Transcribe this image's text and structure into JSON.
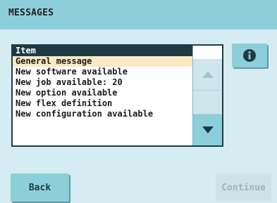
{
  "header": {
    "title": "MESSAGES"
  },
  "list": {
    "column_header": "Item",
    "items": [
      "General message",
      "New software available",
      "New job available: 20",
      "New option available",
      "New flex definition",
      "New configuration available"
    ],
    "selected_index": 0
  },
  "buttons": {
    "back": "Back",
    "continue": "Continue"
  },
  "icons": {
    "info": "info-icon",
    "scroll_up": "triangle-up-icon",
    "scroll_down": "triangle-down-icon"
  },
  "colors": {
    "accent": "#8ccfdb",
    "dark": "#1d3a45",
    "selection": "#fae9c3",
    "panel": "#d5ecf2"
  }
}
